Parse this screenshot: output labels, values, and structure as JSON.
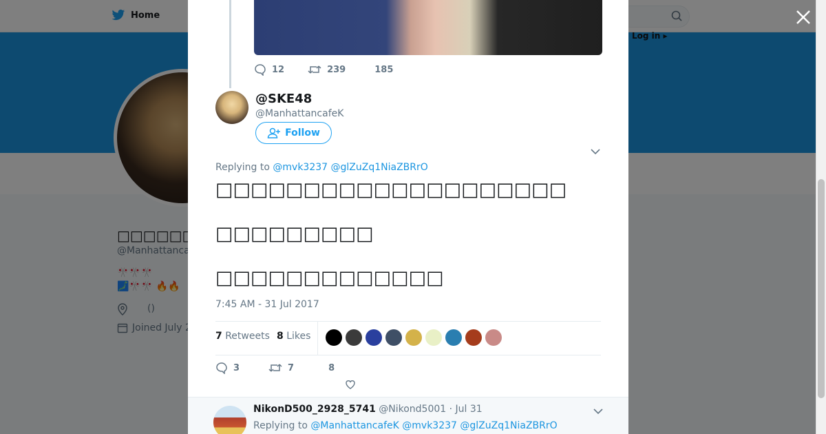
{
  "background": {
    "nav_home": "Home",
    "login": "Log in ▸",
    "profile_name": "□□□□□□□□□",
    "profile_handle": "@Manhattanca",
    "bio_line1": "🎌🎌🎌",
    "bio_line2": "🗾🎌🎌 🔥🔥",
    "location": "()",
    "joined": "Joined July 2"
  },
  "previous_tweet": {
    "replies": "12",
    "retweets": "239",
    "likes": "185"
  },
  "tweet": {
    "display_name": "@SKE48",
    "screen_name": "@ManhattancafeK",
    "follow_label": "Follow",
    "replying_prefix": "Replying to",
    "replying_to": [
      "@mvk3237",
      "@glZuZq1NiaZBRrO"
    ],
    "text_lines": [
      "□□□□□□□□□□□□□□□□□□□□",
      "□□□□□□□□□",
      "□□□□□□□□□□□□□"
    ],
    "timestamp": "7:45 AM - 31 Jul 2017",
    "retweet_count": "7",
    "retweet_label": "Retweets",
    "like_count": "8",
    "like_label": "Likes",
    "likers_colors": [
      "#000000",
      "#3b3b3b",
      "#2a3f9e",
      "#3f4f66",
      "#d4b24a",
      "#e9f0c6",
      "#2a7eb0",
      "#a53c1c",
      "#c98a87"
    ],
    "action_replies": "3",
    "action_retweets": "7",
    "action_likes": "8"
  },
  "reply": {
    "name": "NikonD500_2928_5741",
    "handle": "@Nikond5001",
    "date": "· Jul 31",
    "replying_prefix": "Replying to",
    "replying_to": [
      "@ManhattancafeK",
      "@mvk3237",
      "@glZuZq1NiaZBRrO"
    ]
  },
  "colors": {
    "accent": "#1da1f2",
    "link": "#1b95e0",
    "muted": "#657786",
    "banner": "#1b95e0"
  }
}
